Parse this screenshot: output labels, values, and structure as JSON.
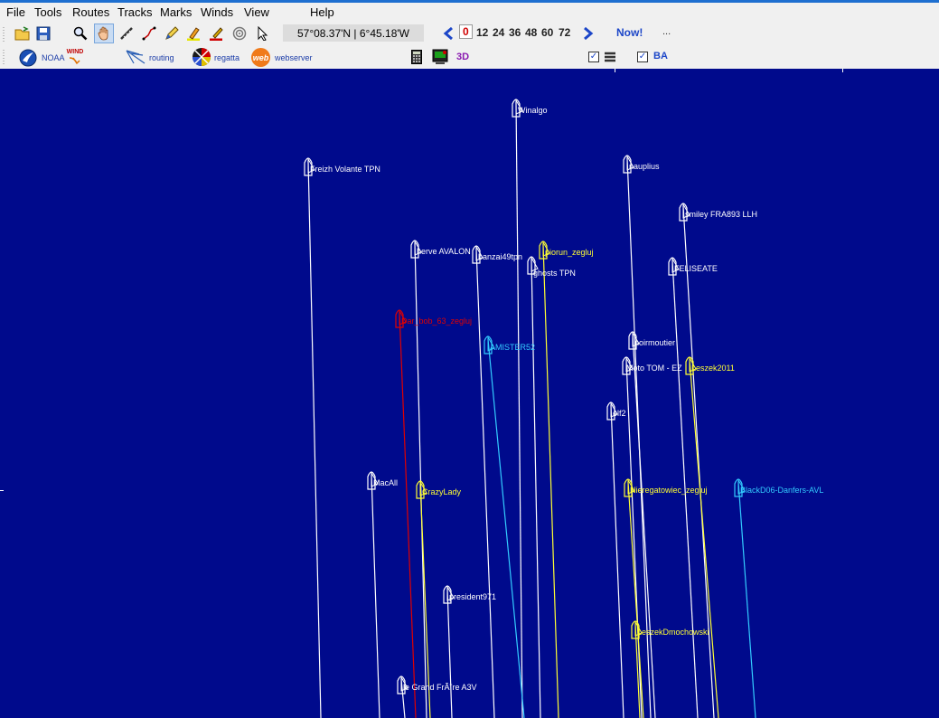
{
  "menu": [
    "File",
    "Tools",
    "Routes",
    "Tracks",
    "Marks",
    "Winds",
    "View",
    "Help"
  ],
  "toolbar": {
    "coordinates": "57°08.37'N |  6°45.18'W",
    "hours": [
      "0",
      "12",
      "24",
      "36",
      "48",
      "60",
      "72"
    ],
    "selected_hour": "0",
    "now_label": "Now!",
    "ellipsis": "...",
    "icons": [
      "open-folder-icon",
      "save-icon",
      "magnifier-icon",
      "hand-pan-icon",
      "ruler-icon",
      "route-icon",
      "pencil-icon",
      "highlighter-icon",
      "brush-icon",
      "target-icon",
      "pointer-icon"
    ]
  },
  "toolbar2": {
    "noaa": "NOAA",
    "wind": "WIND",
    "routing": "routing",
    "regatta": "regatta",
    "web_badge": "web",
    "webserver": "webserver",
    "three_d": "3D",
    "ba_label": "BA",
    "ba_checked": true,
    "layers_checked": true
  },
  "colors": {
    "map_background": "#000a8c",
    "white_boat": "#ffffff",
    "yellow_boat": "#ffff33",
    "cyan_boat": "#33ccff",
    "red_boat": "#e00000"
  },
  "boats": [
    {
      "name": "Winalgo",
      "color": "white"
    },
    {
      "name": "Freizh Volante TPN",
      "color": "white"
    },
    {
      "name": "nauplius",
      "color": "white"
    },
    {
      "name": "smiley FRA893 LLH",
      "color": "white"
    },
    {
      "name": "herve AVALON",
      "color": "white"
    },
    {
      "name": "banzai49tpn",
      "color": "white"
    },
    {
      "name": "piorun_zegluj",
      "color": "yellow"
    },
    {
      "name": "ghosts TPN",
      "color": "white"
    },
    {
      "name": "FELISEATE",
      "color": "white"
    },
    {
      "name": "Dar_bob_63_zegluj",
      "color": "red"
    },
    {
      "name": "AMISTER52",
      "color": "cyan"
    },
    {
      "name": "noirmoutier",
      "color": "white"
    },
    {
      "name": "Moto TOM - EZ",
      "color": "white"
    },
    {
      "name": "Leszek2011",
      "color": "yellow"
    },
    {
      "name": "elf2",
      "color": "white"
    },
    {
      "name": "MacAll",
      "color": "white"
    },
    {
      "name": "CrazyLady",
      "color": "yellow"
    },
    {
      "name": "Nieregatowiec_zegluj",
      "color": "yellow"
    },
    {
      "name": "BlackD06-Danfers-AVL",
      "color": "cyan"
    },
    {
      "name": "president971",
      "color": "white"
    },
    {
      "name": "LeszekDmochowski",
      "color": "yellow"
    },
    {
      "name": "le Grand FrÃ¨re A3V",
      "color": "white"
    }
  ]
}
